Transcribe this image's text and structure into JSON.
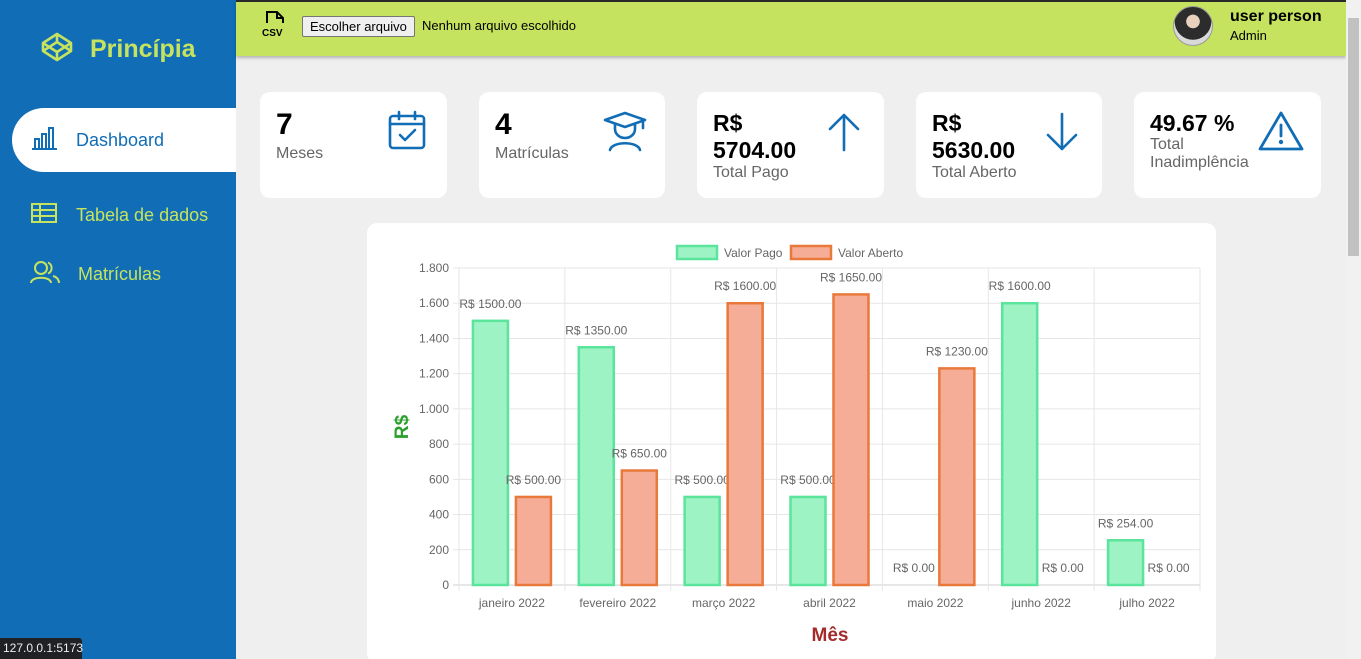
{
  "brand": {
    "name": "Princípia"
  },
  "sidebar": {
    "items": [
      {
        "label": "Dashboard",
        "icon": "bar-chart-icon",
        "active": true
      },
      {
        "label": "Tabela de dados",
        "icon": "table-icon",
        "active": false
      },
      {
        "label": "Matrículas",
        "icon": "users-icon",
        "active": false
      }
    ]
  },
  "topbar": {
    "csv_icon": "csv-file-icon",
    "file_button": "Escolher arquivo",
    "file_status": "Nenhum arquivo escolhido",
    "user_name": "user person",
    "user_role": "Admin"
  },
  "cards": [
    {
      "value": "7",
      "label": "Meses",
      "icon": "calendar-check-icon"
    },
    {
      "value": "4",
      "label": "Matrículas",
      "icon": "graduate-icon"
    },
    {
      "value_line1": "R$",
      "value_line2": "5704.00",
      "label": "Total Pago",
      "icon": "arrow-up-icon"
    },
    {
      "value_line1": "R$",
      "value_line2": "5630.00",
      "label": "Total Aberto",
      "icon": "arrow-down-icon"
    },
    {
      "value": "49.67 %",
      "label_line1": "Total",
      "label_line2": "Inadimplência",
      "icon": "warning-icon"
    }
  ],
  "colors": {
    "sidebar": "#116db5",
    "accent": "#c5e35f",
    "paid_fill": "#9df3c4",
    "paid_border": "#5be49b",
    "open_fill": "#f5ad98",
    "open_border": "#e8793a",
    "ylabel": "#2ca02c",
    "xlabel": "#a52a2a"
  },
  "chart_data": {
    "type": "bar",
    "categories": [
      "janeiro 2022",
      "fevereiro 2022",
      "março 2022",
      "abril 2022",
      "maio 2022",
      "junho 2022",
      "julho 2022"
    ],
    "series": [
      {
        "name": "Valor Pago",
        "values": [
          1500,
          1350,
          500,
          500,
          0,
          1600,
          254
        ],
        "labels": [
          "R$ 1500.00",
          "R$ 1350.00",
          "R$ 500.00",
          "R$ 500.00",
          "R$ 0.00",
          "R$ 1600.00",
          "R$ 254.00"
        ]
      },
      {
        "name": "Valor Aberto",
        "values": [
          500,
          650,
          1600,
          1650,
          1230,
          0,
          0
        ],
        "labels": [
          "R$ 500.00",
          "R$ 650.00",
          "R$ 1600.00",
          "R$ 1650.00",
          "R$ 1230.00",
          "R$ 0.00",
          "R$ 0.00"
        ]
      }
    ],
    "yticks": [
      "0",
      "200",
      "400",
      "600",
      "800",
      "1.000",
      "1.200",
      "1.400",
      "1.600",
      "1.800"
    ],
    "ylim": [
      0,
      1800
    ],
    "xlabel": "Mês",
    "ylabel": "R$",
    "legend": "top",
    "grid": true
  },
  "status_url": "127.0.0.1:5173"
}
